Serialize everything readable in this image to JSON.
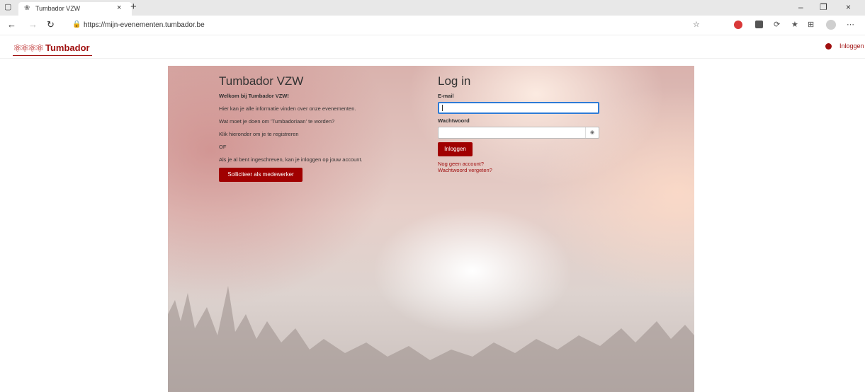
{
  "browser": {
    "tab_title": "Tumbador VZW",
    "url": "https://mijn-evenementen.tumbador.be"
  },
  "header": {
    "brand": "Tumbador",
    "login_link": "Inloggen"
  },
  "intro": {
    "title": "Tumbador VZW",
    "welcome": "Welkom bij Tumbador VZW!",
    "lines": [
      "Hier kan je alle informatie vinden over onze evenementen.",
      "Wat moet je doen om 'Tumbadoriaan' te worden?",
      "Klik hieronder om je te registreren",
      "OF",
      "Als je al bent ingeschreven, kan je inloggen op jouw account."
    ],
    "apply_button": "Solliciteer als medewerker"
  },
  "login": {
    "title": "Log in",
    "email_label": "E-mail",
    "email_value": "",
    "password_label": "Wachtwoord",
    "password_value": "",
    "submit": "Inloggen",
    "no_account": "Nog geen account?",
    "forgot": "Wachtwoord vergeten?"
  },
  "colors": {
    "brand": "#a01010",
    "button": "#a00000",
    "focus": "#2e7bd6"
  }
}
